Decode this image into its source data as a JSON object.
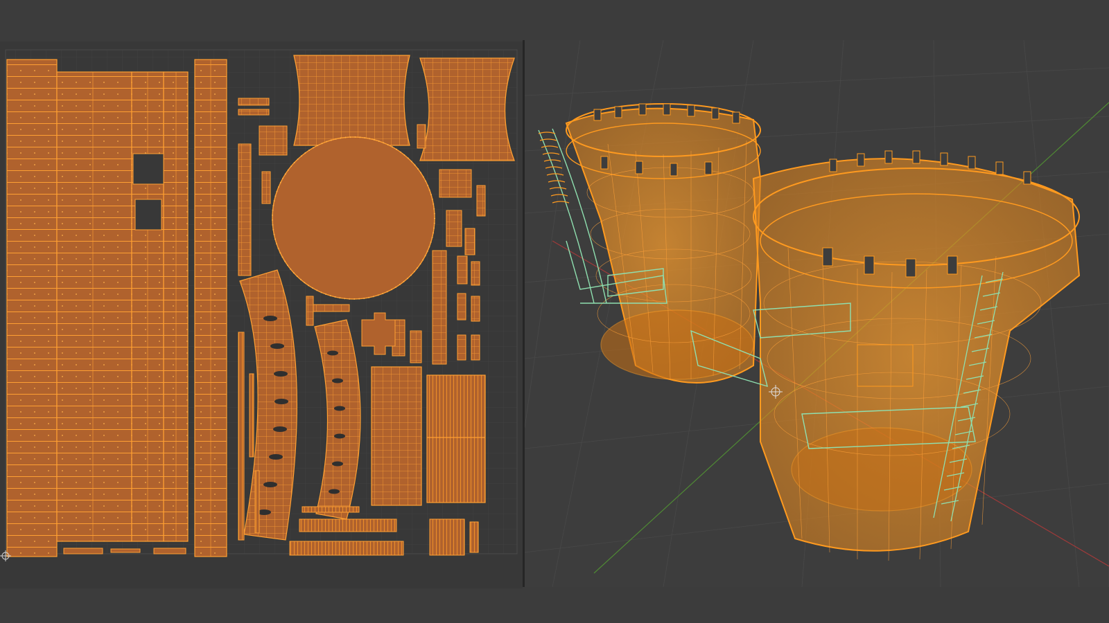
{
  "app": {
    "colors": {
      "background": "#3c3c3c",
      "uv_island_fill": "#b0622d",
      "uv_edge": "#ffa033",
      "uv_vertex": "#ffb24a",
      "wire_orange": "#ff9a1f",
      "wire_selected_green": "#8fe0b0",
      "axis_red": "#a03a3a",
      "axis_green": "#4f8a34",
      "grid_line": "#4a4a4a"
    }
  },
  "uv_editor": {
    "content": "uv-islands-layout",
    "origin_marker_icon": "cursor-crosshair-icon",
    "holes": 2
  },
  "viewport": {
    "content": "tower-wireframe-mesh",
    "mode": "wireframe",
    "floor_grid": true,
    "axes": [
      "x-axis",
      "y-axis"
    ]
  }
}
